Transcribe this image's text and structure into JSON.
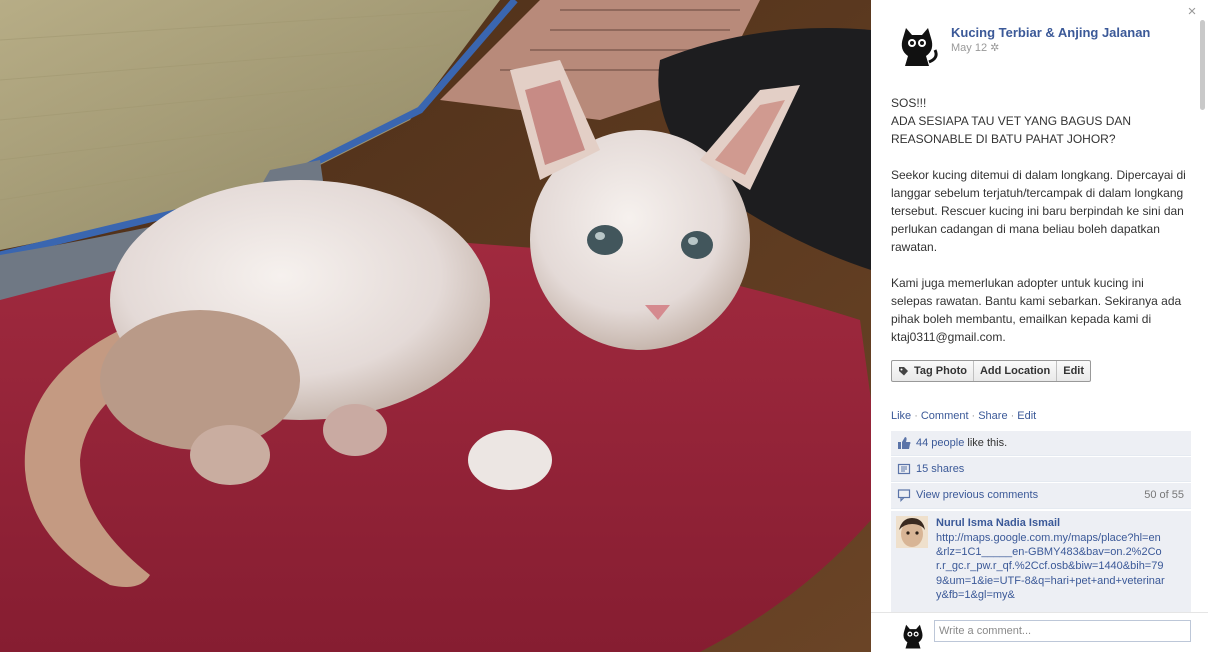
{
  "photo": {
    "description_icon": "photo-of-kitten"
  },
  "header": {
    "page_name": "Kucing Terbiar & Anjing Jalanan",
    "date": "May 12",
    "privacy_icon": "gear-icon"
  },
  "post": {
    "paragraphs": [
      "SOS!!!\nADA SESIAPA TAU VET YANG BAGUS DAN REASONABLE DI BATU PAHAT JOHOR?",
      "Seekor kucing ditemui di dalam longkang. Dipercayai di langgar sebelum terjatuh/tercampak di dalam longkang tersebut. Rescuer kucing ini baru berpindah ke sini dan perlukan cadangan di mana beliau boleh dapatkan rawatan.",
      "Kami juga memerlukan adopter untuk kucing ini selepas rawatan. Bantu kami sebarkan. Sekiranya ada pihak boleh membantu, emailkan kepada kami di ktaj0311@gmail.com."
    ]
  },
  "photo_actions": {
    "tag_photo": "Tag Photo",
    "add_location": "Add Location",
    "edit": "Edit"
  },
  "actions": {
    "like": "Like",
    "comment": "Comment",
    "share": "Share",
    "edit": "Edit",
    "sep": "·"
  },
  "ufi": {
    "likes_link": "44 people",
    "likes_suffix": " like this.",
    "shares": "15 shares",
    "view_previous": "View previous comments",
    "count": "50 of 55"
  },
  "comment": {
    "author": "Nurul Isma Nadia Ismail",
    "text": "http://maps.google.com.my/maps/place?hl=en&rlz=1C1_____en-GBMY483&bav=on.2%2Cor.r_gc.r_pw.r_qf.%2Ccf.osb&biw=1440&bih=799&um=1&ie=UTF-8&q=hari+pet+and+veterinary&fb=1&gl=my&"
  },
  "composer": {
    "placeholder": "Write a comment..."
  },
  "close_label": "×",
  "colors": {
    "link": "#3b5998",
    "ufi_bg": "#edeff4"
  }
}
